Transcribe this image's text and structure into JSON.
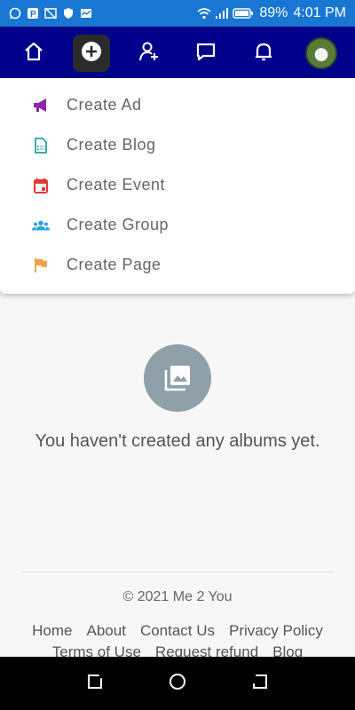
{
  "status_bar": {
    "battery": "89%",
    "time": "4:01 PM",
    "icons_left": [
      "whatsapp-icon",
      "paytm-icon",
      "cast-off-icon",
      "shield-icon",
      "activity-icon"
    ],
    "icons_right": [
      "wifi-icon",
      "signal-icon",
      "battery-icon"
    ]
  },
  "navbar": {
    "items": [
      {
        "name": "home-icon"
      },
      {
        "name": "create-icon",
        "active": true
      },
      {
        "name": "add-friend-icon"
      },
      {
        "name": "messages-icon"
      },
      {
        "name": "notifications-icon"
      },
      {
        "name": "profile-avatar"
      }
    ]
  },
  "create_menu": {
    "items": [
      {
        "label": "Create Ad",
        "icon": "megaphone-icon",
        "color": "#8e24aa"
      },
      {
        "label": "Create Blog",
        "icon": "blog-icon",
        "color": "#26a69a"
      },
      {
        "label": "Create Event",
        "icon": "calendar-icon",
        "color": "#e53935"
      },
      {
        "label": "Create Group",
        "icon": "group-icon",
        "color": "#29a3e0"
      },
      {
        "label": "Create Page",
        "icon": "flag-icon",
        "color": "#f5a04a"
      }
    ]
  },
  "empty_state": {
    "icon": "photo-album-icon",
    "text": "You haven't created any albums yet."
  },
  "footer": {
    "copyright": "© 2021 Me 2 You",
    "links": [
      "Home",
      "About",
      "Contact Us",
      "Privacy Policy",
      "Terms of Use",
      "Request refund",
      "Blog"
    ]
  },
  "system_nav": [
    "recents-icon",
    "home-circle-icon",
    "back-icon"
  ]
}
